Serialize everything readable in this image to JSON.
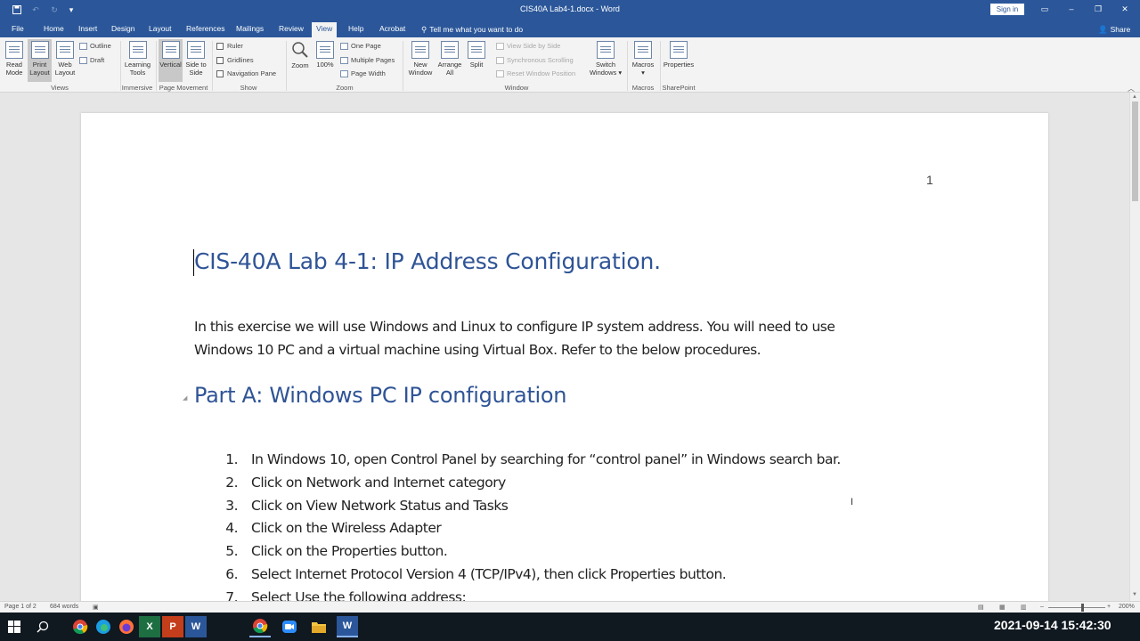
{
  "titlebar": {
    "title": "CIS40A Lab4-1.docx - Word",
    "signin_label": "Sign in",
    "share_label": "Share"
  },
  "tabs": [
    {
      "label": "File"
    },
    {
      "label": "Home"
    },
    {
      "label": "Insert"
    },
    {
      "label": "Design"
    },
    {
      "label": "Layout"
    },
    {
      "label": "References"
    },
    {
      "label": "Mailings"
    },
    {
      "label": "Review"
    },
    {
      "label": "View",
      "active": true
    },
    {
      "label": "Help"
    },
    {
      "label": "Acrobat"
    },
    {
      "label": "Tell me what you want to do"
    }
  ],
  "ribbon": {
    "views": {
      "group_label": "Views",
      "read_mode": "Read Mode",
      "print_layout": "Print Layout",
      "web_layout": "Web Layout",
      "outline": "Outline",
      "draft": "Draft"
    },
    "immersive": {
      "group_label": "Immersive",
      "learning_tools": "Learning Tools"
    },
    "page_movement": {
      "group_label": "Page Movement",
      "vertical": "Vertical",
      "side_to_side": "Side to Side"
    },
    "show": {
      "group_label": "Show",
      "ruler": "Ruler",
      "gridlines": "Gridlines",
      "navigation_pane": "Navigation Pane"
    },
    "zoom": {
      "group_label": "Zoom",
      "zoom": "Zoom",
      "hundred": "100%",
      "one_page": "One Page",
      "multiple_pages": "Multiple Pages",
      "page_width": "Page Width"
    },
    "window": {
      "group_label": "Window",
      "new_window": "New Window",
      "arrange_all": "Arrange All",
      "split": "Split",
      "view_side_by_side": "View Side by Side",
      "synchronous_scrolling": "Synchronous Scrolling",
      "reset_window_position": "Reset Window Position",
      "switch_windows": "Switch Windows"
    },
    "macros": {
      "group_label": "Macros",
      "macros": "Macros"
    },
    "sharepoint": {
      "group_label": "SharePoint",
      "properties": "Properties"
    }
  },
  "document": {
    "page_number": "1",
    "title": "CIS-40A Lab 4-1: IP Address Configuration.",
    "intro_line1": "In this exercise we will use Windows and Linux to configure IP system address. You will need to use",
    "intro_line2": "Windows 10 PC and a virtual machine using Virtual Box. Refer to the below procedures.",
    "part_a_heading": "Part A: Windows PC IP configuration",
    "steps": [
      {
        "num": "1.",
        "text": "In Windows 10, open Control Panel by searching for “control panel” in Windows search bar."
      },
      {
        "num": "2.",
        "text": "Click on Network and Internet category"
      },
      {
        "num": "3.",
        "text": "Click on View Network Status and Tasks"
      },
      {
        "num": "4.",
        "text": "Click on the Wireless Adapter"
      },
      {
        "num": "5.",
        "text": "Click on the Properties button."
      },
      {
        "num": "6.",
        "text": "Select Internet Protocol Version 4 (TCP/IPv4), then click Properties button."
      },
      {
        "num": "7.",
        "text": "Select Use the following address:"
      }
    ]
  },
  "statusbar": {
    "page_info": "Page 1 of 2",
    "word_count": "684 words",
    "zoom_level": "200%"
  },
  "taskbar": {
    "clock": "2021-09-14  15:42:30"
  },
  "colors": {
    "word_blue": "#2b579a",
    "heading_blue": "#2f5496",
    "taskbar": "#101820"
  }
}
